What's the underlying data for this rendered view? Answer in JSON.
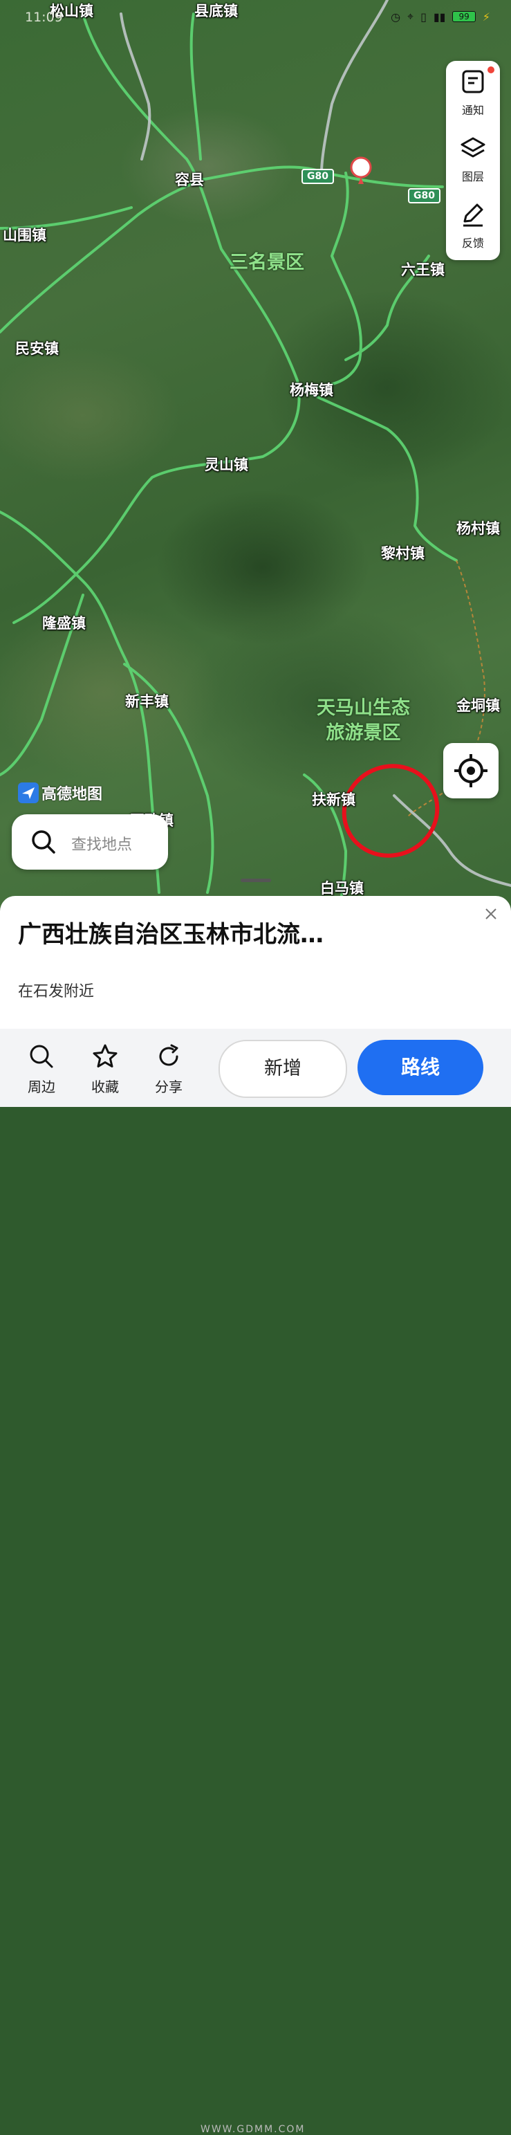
{
  "status_bar": {
    "time": "11:09",
    "battery": "99"
  },
  "map": {
    "places": {
      "songshan": "松山镇",
      "xiandi": "县底镇",
      "rongxian": "容县",
      "shanwei": "山围镇",
      "liuwang": "六王镇",
      "minan": "民安镇",
      "yangmei": "杨梅镇",
      "lingshan": "灵山镇",
      "yangcun": "杨村镇",
      "licun": "黎村镇",
      "longsheng": "隆盛镇",
      "xinfeng": "新丰镇",
      "jintong": "金垌镇",
      "fuxin": "扶新镇",
      "zhizhi": "至致镇",
      "baima": "白马镇"
    },
    "scenic": {
      "sanming": "三名景区",
      "tianmashan_line1": "天马山生态",
      "tianmashan_line2": "旅游景区"
    },
    "highway_shield": "G80",
    "logo_text": "高德地图"
  },
  "side_panel": {
    "notice": "通知",
    "layers": "图层",
    "feedback": "反馈"
  },
  "search": {
    "placeholder": "查找地点"
  },
  "sheet": {
    "title": "广西壮族自治区玉林市北流…",
    "subtitle": "在石发附近"
  },
  "actions": {
    "nearby": "周边",
    "favorite": "收藏",
    "share": "分享",
    "add": "新增",
    "route": "路线"
  },
  "colors": {
    "route_button": "#1f6ff2",
    "road": "#4fd36a",
    "annotation_circle": "#e8101c"
  },
  "watermark": "WWW.GDMM.COM"
}
